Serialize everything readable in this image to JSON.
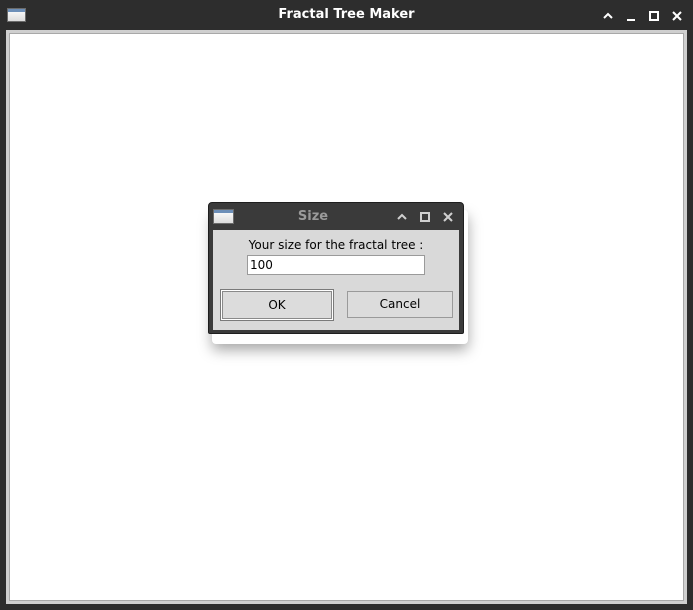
{
  "main_window": {
    "title": "Fractal Tree Maker",
    "controls": [
      "chevron-up-icon",
      "minimize-icon",
      "maximize-icon",
      "close-icon"
    ]
  },
  "dialog": {
    "title": "Size",
    "label": "Your size for the fractal tree :",
    "input_value": "100",
    "ok_label": "OK",
    "cancel_label": "Cancel",
    "controls": [
      "chevron-up-icon",
      "maximize-icon",
      "close-icon"
    ]
  },
  "colors": {
    "titlebar": "#2d2d2d",
    "dialog_body": "#d9d9d9",
    "canvas": "#ffffff"
  }
}
